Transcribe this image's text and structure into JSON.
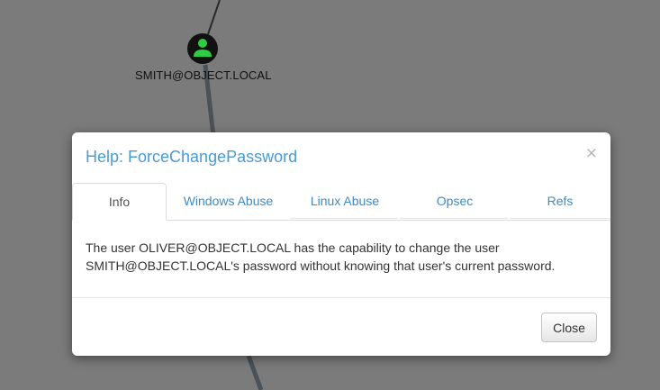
{
  "graph": {
    "node": {
      "label": "SMITH@OBJECT.LOCAL",
      "icon": "user-icon"
    }
  },
  "modal": {
    "title": "Help: ForceChangePassword",
    "close_symbol": "×",
    "tabs": [
      {
        "label": "Info",
        "active": true
      },
      {
        "label": "Windows Abuse",
        "active": false
      },
      {
        "label": "Linux Abuse",
        "active": false
      },
      {
        "label": "Opsec",
        "active": false
      },
      {
        "label": "Refs",
        "active": false
      }
    ],
    "body_text": "The user OLIVER@OBJECT.LOCAL has the capability to change the user SMITH@OBJECT.LOCAL's password without knowing that user's current password.",
    "close_button_label": "Close"
  },
  "colors": {
    "background": "#7b7b7b",
    "title": "#4a9bd3",
    "tab_link": "#3c8bc8",
    "node_icon": "#2ecc40"
  }
}
